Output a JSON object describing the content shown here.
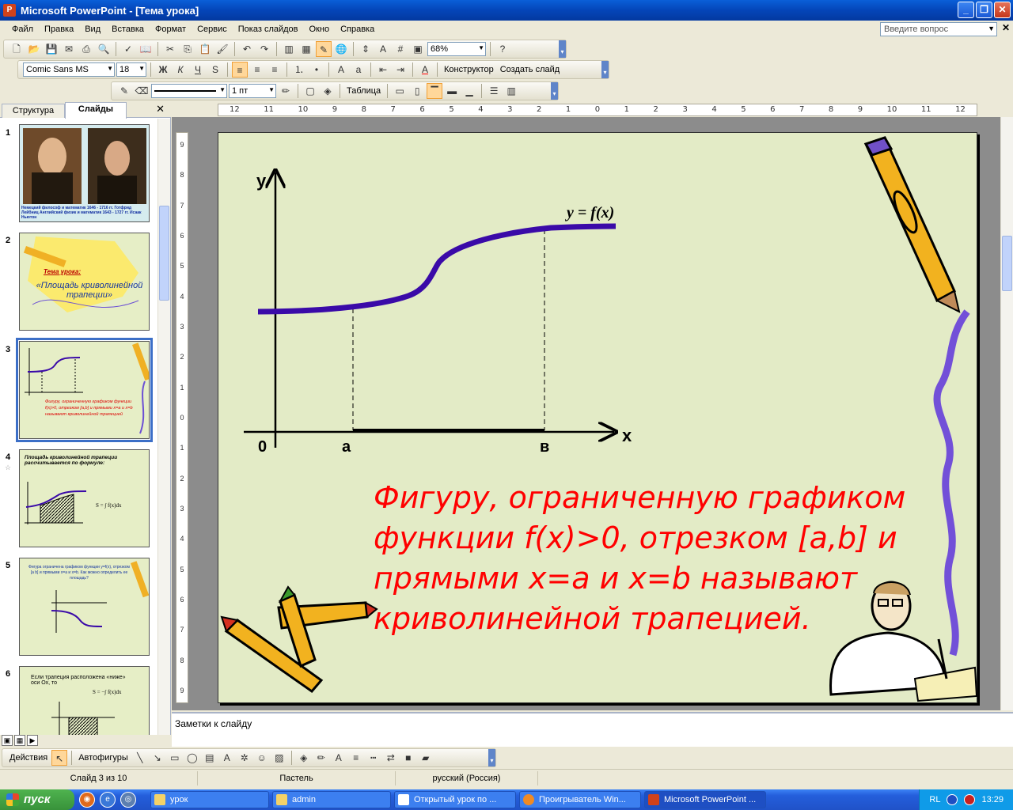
{
  "window": {
    "title": "Microsoft PowerPoint - [Тема урока]"
  },
  "menu": [
    "Файл",
    "Правка",
    "Вид",
    "Вставка",
    "Формат",
    "Сервис",
    "Показ слайдов",
    "Окно",
    "Справка"
  ],
  "ask_placeholder": "Введите вопрос",
  "toolbar": {
    "zoom": "68%",
    "font": "Comic Sans MS",
    "font_size": "18",
    "design_label": "Конструктор",
    "new_slide_label": "Создать слайд",
    "line_width": "1 пт",
    "table_label": "Таблица"
  },
  "pane": {
    "tab_outline": "Структура",
    "tab_slides": "Слайды"
  },
  "thumbs": [
    {
      "num": "1",
      "text": "Немецкий философ и математик 1646 - 1716 гг. Готфрид Лейбниц   Английский физик и математик 1643 - 1727 гг. Исаак Ньютон"
    },
    {
      "num": "2",
      "text": "Тема урока:",
      "text2": "«Площадь криволинейной трапеции»"
    },
    {
      "num": "3",
      "text": "Фигуру, ограниченную графиком функции f(x)>0, отрезком [a,b] и прямыми x=a и x=b называют криволинейной трапецией"
    },
    {
      "num": "4",
      "text": "Площадь криволинейной трапеции рассчитывается по формуле:"
    },
    {
      "num": "5",
      "text": "Фигура ограничена графиком функции y=f(x), отрезком [a b] и прямыми x=a и x=b. Как можно определить ее площадь?"
    },
    {
      "num": "6",
      "text": "Если трапеция расположена «ниже» оси Ох, то"
    }
  ],
  "slide": {
    "axis_y": "у",
    "axis_x": "х",
    "origin": "0",
    "label_a": "а",
    "label_b": "в",
    "func_label": "y = f(x)",
    "text_lines": [
      "Фигуру, ограниченную графиком",
      "функции f(x)>0, отрезком [a,b] и",
      "прямыми x=a и x=b называют",
      "криволинейной трапецией."
    ],
    "text_color": "#ff0000",
    "curve_color": "#3a0aa8"
  },
  "notes": "Заметки к слайду",
  "drawing": {
    "actions": "Действия",
    "autoshapes": "Автофигуры"
  },
  "status": {
    "slide": "Слайд 3 из 10",
    "design": "Пастель",
    "lang": "русский (Россия)"
  },
  "taskbar": {
    "start": "пуск",
    "tasks": [
      "урок",
      "admin",
      "Открытый урок по ...",
      "Проигрыватель Win...",
      "Microsoft PowerPoint ..."
    ],
    "lang": "RL",
    "time": "13:29"
  }
}
